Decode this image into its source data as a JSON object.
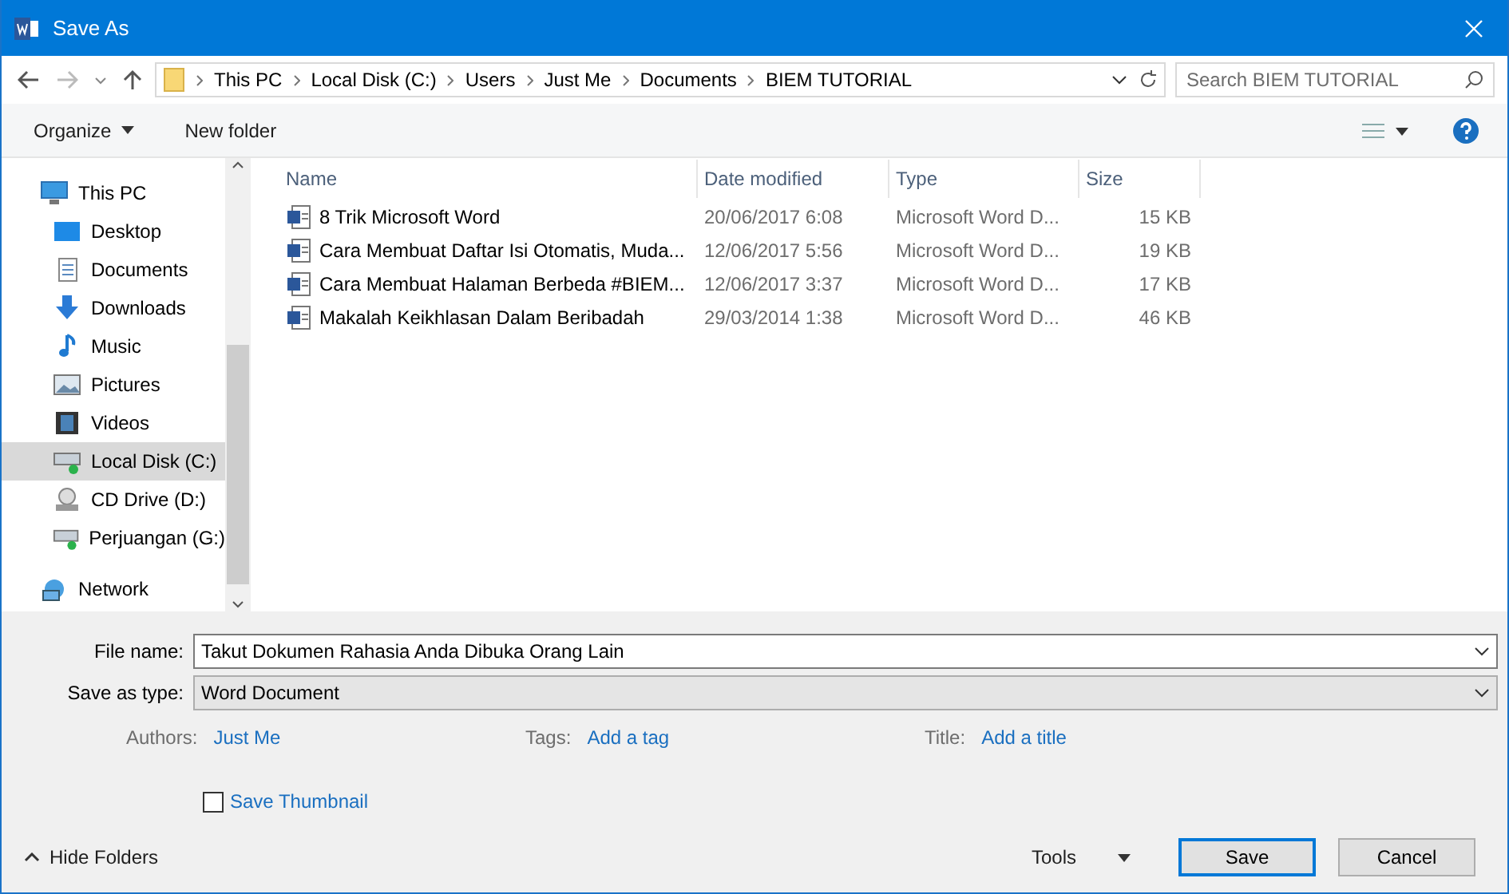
{
  "window": {
    "title": "Save As"
  },
  "address": {
    "crumbs": [
      "This PC",
      "Local Disk (C:)",
      "Users",
      "Just Me",
      "Documents",
      "BIEM TUTORIAL"
    ]
  },
  "search": {
    "placeholder": "Search BIEM TUTORIAL"
  },
  "toolbar": {
    "organize": "Organize",
    "new_folder": "New folder"
  },
  "sidebar": {
    "items": [
      {
        "label": "This PC",
        "selected": false,
        "children": [
          {
            "label": "Desktop",
            "selected": false
          },
          {
            "label": "Documents",
            "selected": false
          },
          {
            "label": "Downloads",
            "selected": false
          },
          {
            "label": "Music",
            "selected": false
          },
          {
            "label": "Pictures",
            "selected": false
          },
          {
            "label": "Videos",
            "selected": false
          },
          {
            "label": "Local Disk (C:)",
            "selected": true
          },
          {
            "label": "CD Drive (D:)",
            "selected": false
          },
          {
            "label": "Perjuangan (G:)",
            "selected": false
          }
        ]
      },
      {
        "label": "Network",
        "selected": false
      }
    ]
  },
  "table": {
    "columns": [
      "Name",
      "Date modified",
      "Type",
      "Size"
    ],
    "rows": [
      [
        "8 Trik Microsoft Word",
        "20/06/2017 6:08",
        "Microsoft Word D...",
        "15 KB"
      ],
      [
        "Cara Membuat Daftar Isi Otomatis, Muda...",
        "12/06/2017 5:56",
        "Microsoft Word D...",
        "19 KB"
      ],
      [
        "Cara Membuat Halaman Berbeda #BIEM...",
        "12/06/2017 3:37",
        "Microsoft Word D...",
        "17 KB"
      ],
      [
        "Makalah Keikhlasan Dalam Beribadah",
        "29/03/2014 1:38",
        "Microsoft Word D...",
        "46 KB"
      ]
    ]
  },
  "form": {
    "file_name_label": "File name:",
    "file_name": "Takut Dokumen Rahasia Anda Dibuka Orang Lain",
    "type_label": "Save as type:",
    "type": "Word Document",
    "meta": [
      {
        "label": "Authors:",
        "value": "Just Me"
      },
      {
        "label": "Tags:",
        "value": "Add a tag"
      },
      {
        "label": "Title:",
        "value": "Add a title"
      }
    ],
    "thumbnail": {
      "label": "Save Thumbnail",
      "checked": false
    }
  },
  "footer": {
    "hide_folders": "Hide Folders",
    "tools": "Tools",
    "save": "Save",
    "cancel": "Cancel"
  }
}
